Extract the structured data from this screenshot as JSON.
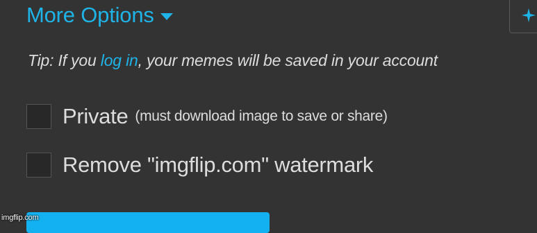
{
  "more_options": {
    "label": "More Options",
    "caret_icon": "caret-down-icon",
    "color": "#1fb4e8"
  },
  "side_button": {
    "icon": "sparkle-icon"
  },
  "tip": {
    "prefix": "Tip: If you ",
    "link": "log in",
    "suffix": ", your memes will be saved in your account"
  },
  "options": {
    "private": {
      "label": "Private",
      "note": "(must download image to save or share)",
      "checked": false
    },
    "watermark": {
      "label": "Remove \"imgflip.com\" watermark",
      "checked": false
    }
  },
  "watermark_logo": "imgflip.com",
  "colors": {
    "background": "#333333",
    "accent": "#1fb4e8",
    "button": "#14b1f0",
    "text": "#dddddd"
  }
}
